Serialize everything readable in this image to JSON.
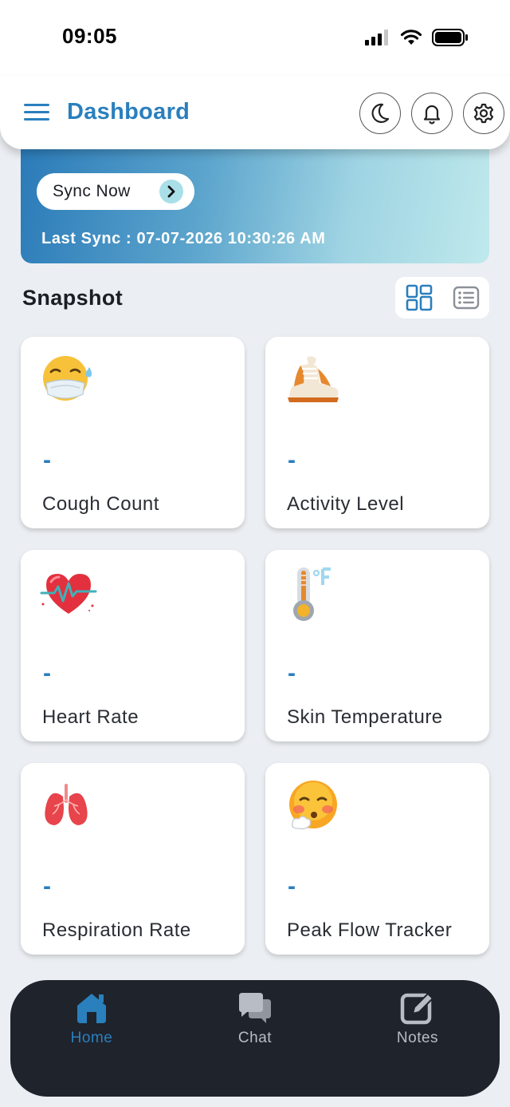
{
  "status_bar": {
    "time": "09:05"
  },
  "header": {
    "title": "Dashboard"
  },
  "sync": {
    "button_label": "Sync Now",
    "last_sync": "Last Sync : 07-07-2026 10:30:26 AM"
  },
  "snapshot": {
    "title": "Snapshot",
    "cards": [
      {
        "label": "Cough Count",
        "value": "-",
        "icon": "masked-face-icon"
      },
      {
        "label": "Activity Level",
        "value": "-",
        "icon": "sneaker-icon"
      },
      {
        "label": "Heart Rate",
        "value": "-",
        "icon": "heart-pulse-icon"
      },
      {
        "label": "Skin Temperature",
        "value": "-",
        "icon": "thermometer-icon"
      },
      {
        "label": "Respiration Rate",
        "value": "-",
        "icon": "lungs-icon"
      },
      {
        "label": "Peak Flow Tracker",
        "value": "-",
        "icon": "exhaling-face-icon"
      }
    ]
  },
  "bottom_nav": {
    "items": [
      {
        "label": "Home",
        "active": true
      },
      {
        "label": "Chat",
        "active": false
      },
      {
        "label": "Notes",
        "active": false
      }
    ]
  },
  "colors": {
    "accent": "#2a7fbd",
    "background": "#ebeef2",
    "nav_background": "#1f232c",
    "nav_inactive": "#b8bcc4"
  }
}
